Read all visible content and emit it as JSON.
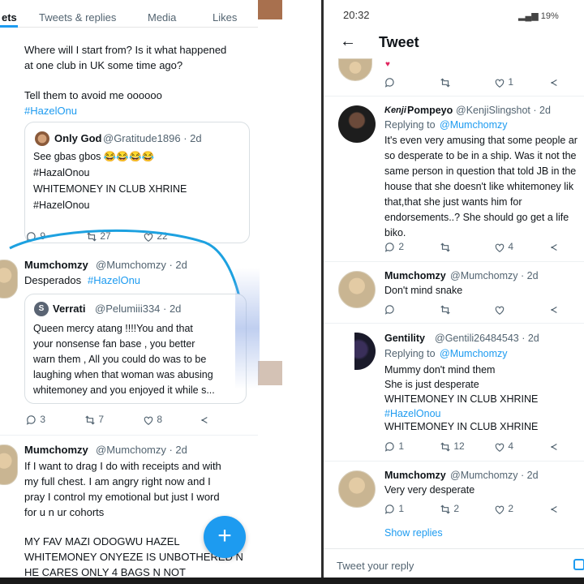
{
  "left": {
    "tabs": [
      "ets",
      "Tweets & replies",
      "Media",
      "Likes"
    ],
    "top_tweet": {
      "line1": "Where will I start from? Is it what happened",
      "line2": "at one club in UK some time ago?",
      "line3": "Tell them to avoid me oooooo",
      "hashtag": "#HazelOnu",
      "quote": {
        "name": "Only God",
        "handle": "@Gratitude1896 · 2d",
        "lines": [
          "See gbas gbos 😂😂😂😂",
          "#HazalOnou",
          "WHITEMONEY IN CLUB XHRINE",
          "#HazelOnou"
        ],
        "counts": [
          "9",
          "27",
          "22"
        ]
      }
    },
    "tweet2": {
      "name": "Mumchomzy",
      "handle": "@Mumchomzy · 2d",
      "text": "Desperados",
      "hashtag": "#HazelOnu",
      "quote": {
        "name": "Verrati",
        "handle": "@Pelumiii334 · 2d",
        "lines": [
          "Queen mercy atang !!!!You and that",
          "your nonsense fan base , you better",
          "warn them , All you could do was to be",
          "laughing when that woman was abusing",
          "whitemoney and you enjoyed it while s..."
        ]
      },
      "counts": [
        "3",
        "7",
        "8"
      ]
    },
    "tweet3": {
      "name": "Mumchomzy",
      "handle": "@Mumchomzy · 2d",
      "lines": [
        "If I want to drag I do with receipts and with",
        "my full chest. I am angry right now and I",
        "pray I control my emotional but just I word",
        "for u n ur cohorts",
        "",
        "MY FAV MAZI ODOGWU HAZEL",
        "WHITEMONEY ONYEZE IS UNBOTHERED N",
        "HE CARES ONLY 4 BAGS N NOT"
      ]
    },
    "fab_label": "+"
  },
  "right": {
    "status": {
      "time": "20:32",
      "battery": "19%"
    },
    "header_title": "Tweet",
    "top_counts": [
      "",
      "",
      "1"
    ],
    "tweets": [
      {
        "name": "Pompeyo",
        "name_prefix": "Kenji",
        "handle": "@KenjiSlingshot · 2d",
        "replying": "Replying to",
        "replying_handle": "@Mumchomzy",
        "lines": [
          "It's even very amusing that some people ar",
          "so desperate to be in a ship. Was it not the",
          "same person in question that told JB in the",
          "house that she doesn't like whitemoney lik",
          "that,that she just wants him for",
          "endorsements..? She should go get a life",
          "biko."
        ],
        "counts": [
          "2",
          "",
          "4"
        ]
      },
      {
        "name": "Mumchomzy",
        "handle": "@Mumchomzy · 2d",
        "lines": [
          "Don't mind snake"
        ],
        "counts": [
          "",
          "",
          ""
        ]
      },
      {
        "name": "Gentility",
        "handle": "@Gentili26484543 · 2d",
        "replying": "Replying to",
        "replying_handle": "@Mumchomzy",
        "lines": [
          "Mummy don't mind them",
          "She is just desperate",
          "WHITEMONEY IN CLUB XHRINE"
        ],
        "hashtag": "#HazelOnou",
        "last_line": "WHITEMONEY IN CLUB XHRINE",
        "counts": [
          "1",
          "12",
          "4"
        ]
      },
      {
        "name": "Mumchomzy",
        "handle": "@Mumchomzy · 2d",
        "lines": [
          "Very very desperate"
        ],
        "counts": [
          "1",
          "2",
          "2"
        ]
      }
    ],
    "show_replies": "Show replies",
    "reply_placeholder": "Tweet your reply"
  },
  "colors": {
    "accent": "#1d9bf0",
    "text": "#0f1419",
    "muted": "#536471"
  }
}
